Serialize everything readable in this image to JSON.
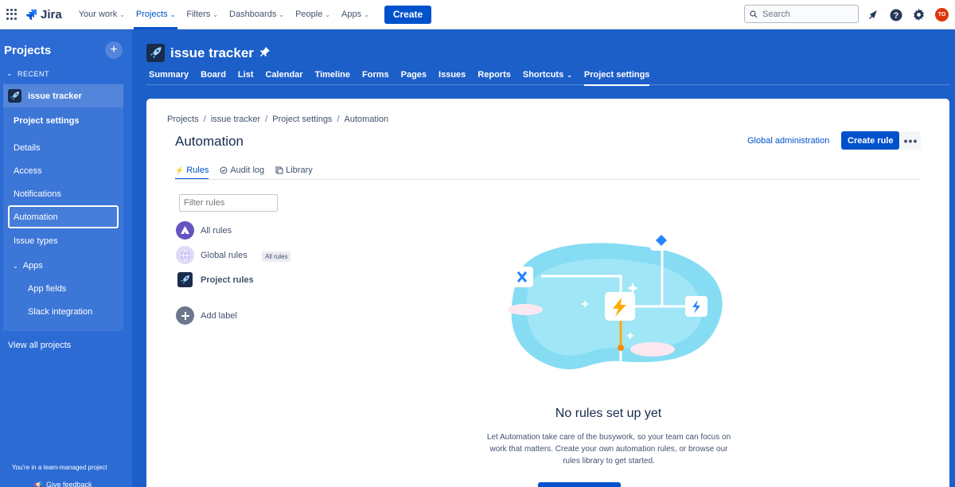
{
  "topnav": {
    "logo": "Jira",
    "items": [
      {
        "label": "Your work"
      },
      {
        "label": "Projects"
      },
      {
        "label": "Filters"
      },
      {
        "label": "Dashboards"
      },
      {
        "label": "People"
      },
      {
        "label": "Apps"
      }
    ],
    "create_label": "Create",
    "search_placeholder": "Search",
    "avatar_initials": "TO"
  },
  "sidebar": {
    "title": "Projects",
    "recent_label": "RECENT",
    "project_name": "issue tracker",
    "section_title": "Project settings",
    "items": [
      "Details",
      "Access",
      "Notifications",
      "Automation",
      "Issue types"
    ],
    "apps_label": "Apps",
    "app_items": [
      "App fields",
      "Slack integration"
    ],
    "view_all": "View all projects",
    "footer_note": "You're in a team-managed project",
    "feedback": "Give feedback"
  },
  "project": {
    "title": "issue tracker",
    "tabs": [
      "Summary",
      "Board",
      "List",
      "Calendar",
      "Timeline",
      "Forms",
      "Pages",
      "Issues",
      "Reports",
      "Shortcuts",
      "Project settings"
    ]
  },
  "main": {
    "breadcrumb": [
      "Projects",
      "issue tracker",
      "Project settings",
      "Automation"
    ],
    "title": "Automation",
    "global_admin": "Global administration",
    "create_rule": "Create rule",
    "subtabs": [
      "Rules",
      "Audit log",
      "Library"
    ],
    "filter_placeholder": "Filter rules",
    "rule_items": [
      "All rules",
      "Global rules",
      "Project rules"
    ],
    "add_label": "Add label",
    "tooltip": "All rules",
    "empty_title": "No rules set up yet",
    "empty_desc": "Let Automation take care of the busywork, so your team can focus on work that matters. Create your own automation rules, or browse our rules library to get started."
  },
  "colors": {
    "brand_blue": "#0052cc",
    "sidebar_blue": "#2c6bd4",
    "page_blue": "#1d5fc9"
  }
}
